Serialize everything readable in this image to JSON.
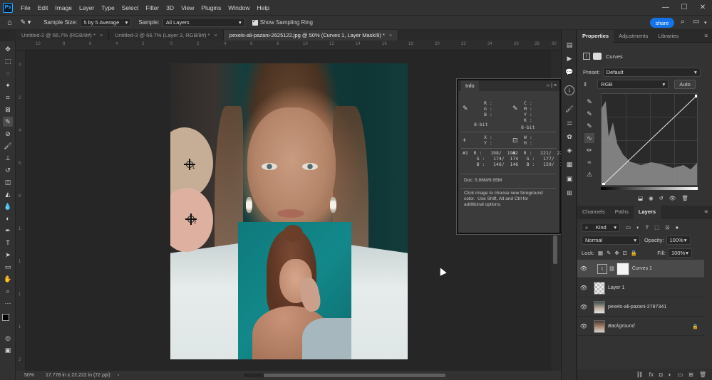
{
  "menubar": {
    "logo": "Ps",
    "items": [
      "File",
      "Edit",
      "Image",
      "Layer",
      "Type",
      "Select",
      "Filter",
      "3D",
      "View",
      "Plugins",
      "Window",
      "Help"
    ],
    "controls": [
      "—",
      "☐",
      "✕"
    ]
  },
  "options": {
    "sample_size_label": "Sample Size:",
    "sample_size_value": "5 by 5 Average",
    "sample_label": "Sample:",
    "sample_value": "All Layers",
    "show_ring_label": "Show Sampling Ring",
    "share_label": "share"
  },
  "tabs": [
    {
      "label": "Untitled-2 @ 66.7% (RGB/8#) *"
    },
    {
      "label": "Untitled-3 @ 66.7% (Layer 3, RGB/8#) *"
    },
    {
      "label": "pexels-ali-pazani-2625122.jpg @ 50% (Curves 1, Layer Mask/8) *"
    }
  ],
  "ruler": {
    "top": [
      "10",
      "8",
      "6",
      "4",
      "2",
      "0",
      "2",
      "4",
      "6",
      "8",
      "10",
      "12",
      "14",
      "16",
      "18",
      "20",
      "22",
      "24",
      "26",
      "28",
      "30"
    ],
    "left": [
      "0",
      "2",
      "4",
      "6",
      "8",
      "1",
      "1",
      "1",
      "1",
      "2"
    ]
  },
  "samplers": [
    {
      "num": "1"
    },
    {
      "num": "2"
    }
  ],
  "info": {
    "tab": "Info",
    "header_right": "›› | ≡",
    "rgb_block": "R :\nG :\nB :",
    "cmyk_block": "C :\nM :\nY :\nK :",
    "bit_left": "8-bit",
    "bit_right": "8-bit",
    "xy_block": "X :\nY :",
    "wh_block": "W :\nH :",
    "s1": "#1  R :   198/  198\n     G :   174/  174\n     B :   146/  146",
    "s2": "#2  R :   221/  221\n     G :   177/  177\n     B :   159/  159",
    "doc": "Doc: 5.86M/9.95M",
    "help": "Click image to choose new foreground\ncolor.  Use Shift, Alt and Ctrl for\nadditional options."
  },
  "status": {
    "zoom": "50%",
    "doc_size": "17.778 in x 22.222 in (72 ppi)"
  },
  "properties": {
    "tabs": [
      "Properties",
      "Adjustments",
      "Libraries"
    ],
    "title": "Curves",
    "preset_label": "Preset:",
    "preset_value": "Default",
    "channel_value": "RGB",
    "auto_label": "Auto"
  },
  "layers_panel": {
    "tabs": [
      "Channels",
      "Paths",
      "Layers"
    ],
    "kind_label": "Kind",
    "blend_mode": "Normal",
    "opacity_label": "Opacity:",
    "opacity_value": "100%",
    "lock_label": "Lock:",
    "fill_label": "Fill:",
    "fill_value": "100%",
    "layers": [
      {
        "name": "Curves 1",
        "selected": true
      },
      {
        "name": "Layer 1",
        "selected": false
      },
      {
        "name": "pexels-ali-pazani-2787341",
        "selected": false
      },
      {
        "name": "Background",
        "selected": false
      }
    ],
    "footer_icons": [
      "link-icon",
      "fx-icon",
      "mask-icon",
      "adjustment-icon",
      "group-icon",
      "new-layer-icon",
      "trash-icon"
    ]
  },
  "colors": {
    "accent": "#1473e6",
    "canvas_bg": "#262626",
    "panel_bg": "#333333"
  }
}
